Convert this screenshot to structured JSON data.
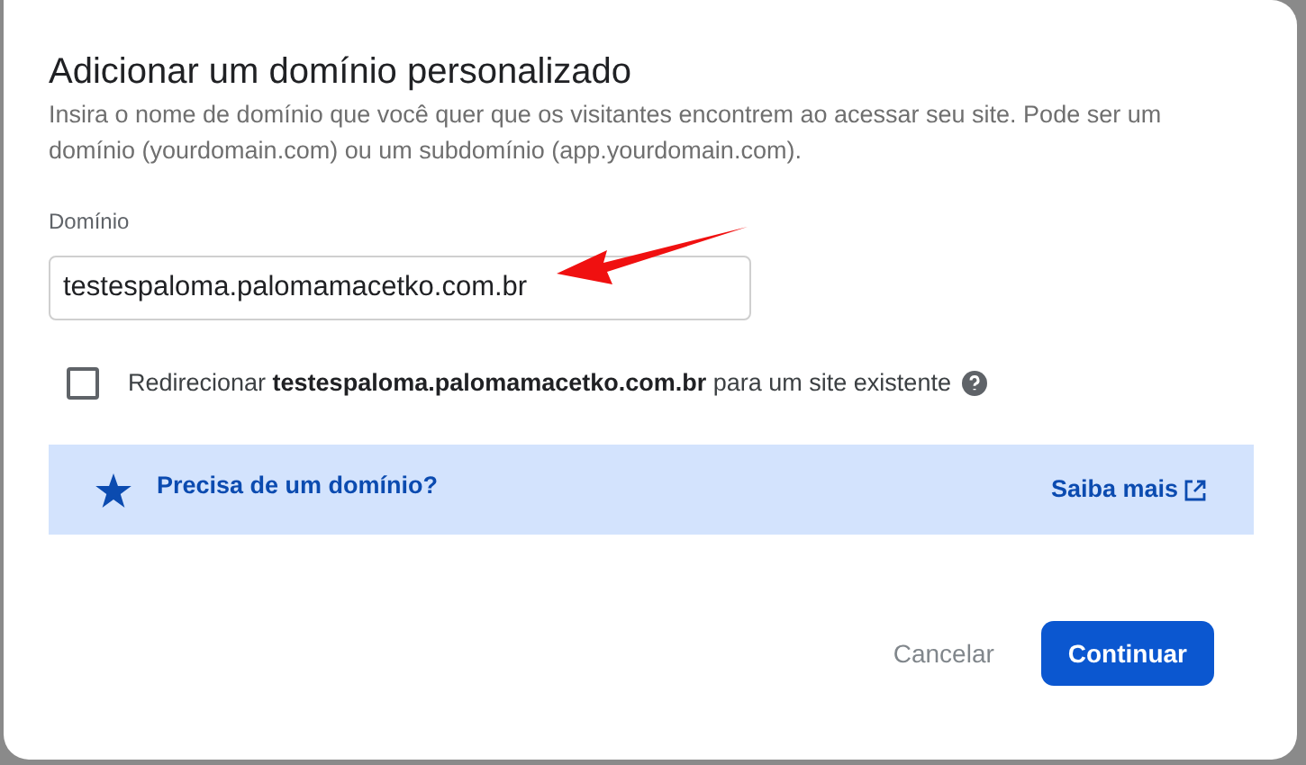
{
  "dialog": {
    "title": "Adicionar um domínio personalizado",
    "description": "Insira o nome de domínio que você quer que os visitantes encontrem ao acessar seu site. Pode ser um domínio (yourdomain.com) ou um subdomínio (app.yourdomain.com).",
    "field": {
      "label": "Domínio",
      "value": "testespaloma.palomamacetko.com.br"
    },
    "redirect": {
      "label": "Redirecionar **testespaloma.palomamacetko.com.br** para um site existente",
      "checked": false
    },
    "banner": {
      "text": "Precisa de um domínio?",
      "link": "Saiba mais"
    },
    "buttons": [
      {
        "label": "Cancelar",
        "kind": "text"
      },
      {
        "label": "Continuar",
        "kind": "primary"
      }
    ]
  }
}
